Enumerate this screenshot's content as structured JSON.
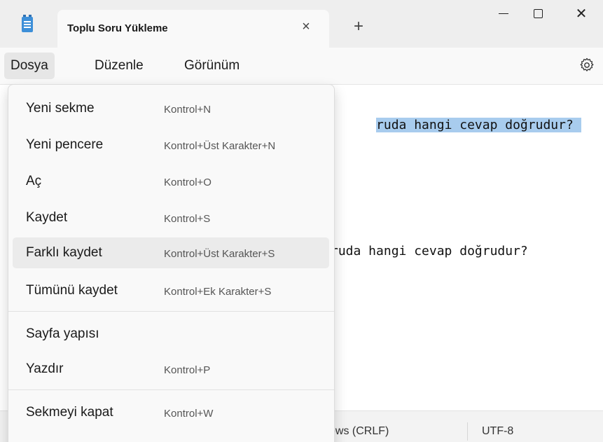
{
  "window": {
    "tab_title": "Toplu Soru Yükleme",
    "tab_close_glyph": "×",
    "new_tab_glyph": "+",
    "close_glyph": "✕"
  },
  "menubar": {
    "items": [
      "Dosya",
      "Düzenle",
      "Görünüm"
    ]
  },
  "editor": {
    "line1_visible": "ruda hangi cevap doğrudur?",
    "line2_visible": "ruda hangi cevap doğrudur?",
    "selection_color": "#a8ccee"
  },
  "statusbar": {
    "line_ending": "ows (CRLF)",
    "encoding": "UTF-8"
  },
  "file_menu": {
    "items": [
      {
        "label": "Yeni sekme",
        "shortcut": "Kontrol+N"
      },
      {
        "label": "Yeni pencere",
        "shortcut": "Kontrol+Üst Karakter+N"
      },
      {
        "label": "Aç",
        "shortcut": "Kontrol+O"
      },
      {
        "label": "Kaydet",
        "shortcut": "Kontrol+S"
      },
      {
        "label": "Farklı kaydet",
        "shortcut": "Kontrol+Üst Karakter+S"
      },
      {
        "label": "Tümünü kaydet",
        "shortcut": "Kontrol+Ek Karakter+S"
      },
      {
        "label": "Sayfa yapısı",
        "shortcut": ""
      },
      {
        "label": "Yazdır",
        "shortcut": "Kontrol+P"
      },
      {
        "label": "Sekmeyi kapat",
        "shortcut": "Kontrol+W"
      }
    ],
    "hovered_item": "Farklı kaydet"
  },
  "colors": {
    "titlebar_bg": "#eeeeee",
    "menu_bg": "#f9f9f9",
    "hover_bg": "#ebebeb",
    "accent_icon": "#3d8fd8"
  }
}
